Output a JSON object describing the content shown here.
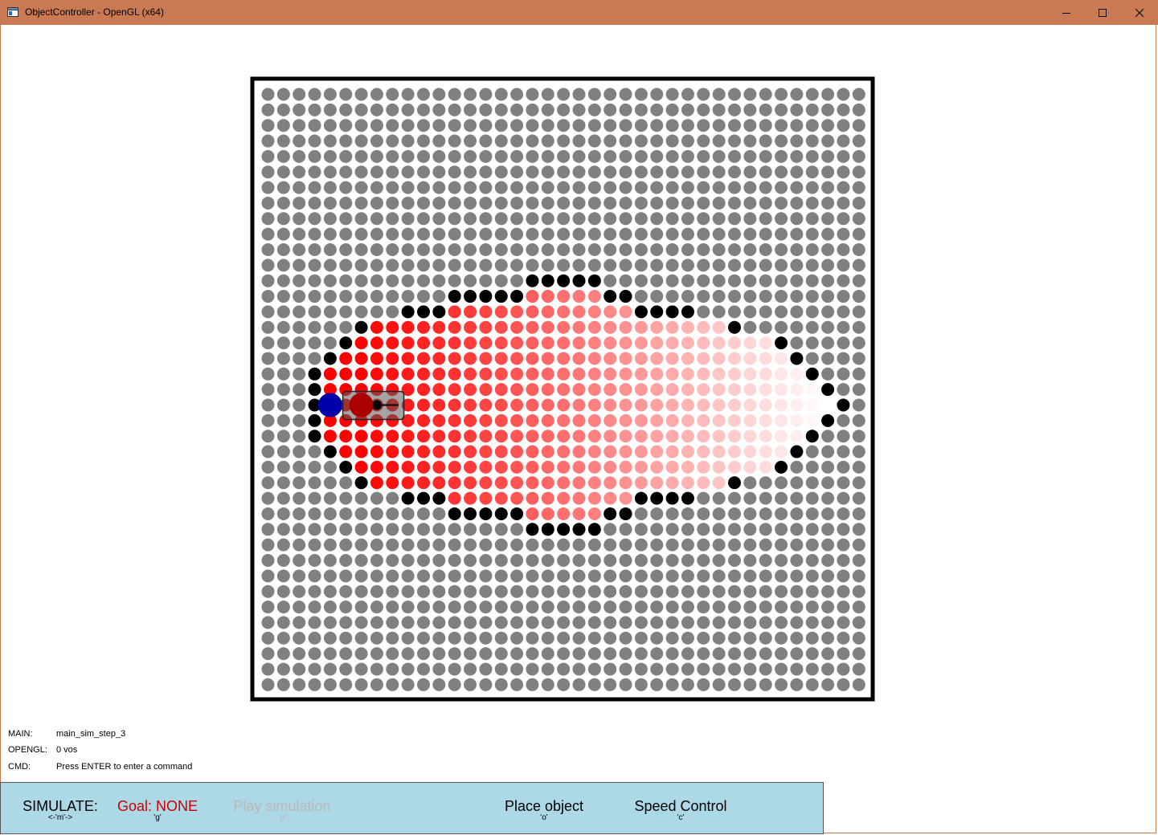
{
  "window": {
    "title": "ObjectController - OpenGL (x64)",
    "app_icon": "app-window-icon",
    "controls": [
      "minimize-icon",
      "maximize-icon",
      "close-icon"
    ]
  },
  "colors": {
    "titlebar": "#c97a52",
    "toolbar": "#add8e6",
    "empty_cell": "#808080",
    "wall_cell": "#000000",
    "path_cell_strong": "#ff0000",
    "path_cell_faint": "#ffffff",
    "start_marker": "#0000aa",
    "object_marker": "#aa0000",
    "goal_text": "#cc0000",
    "disabled_text": "#b8b8b8"
  },
  "grid": {
    "columns": 39,
    "rows": 39,
    "cell_states": [
      "empty",
      "wall",
      "path"
    ],
    "start_cell": {
      "col": 4,
      "row": 20
    },
    "object_cell": {
      "col": 6,
      "row": 20
    }
  },
  "status": {
    "main_label": "MAIN:",
    "main_value": "main_sim_step_3",
    "opengl_label": "OPENGL:",
    "opengl_value": "0 vos",
    "cmd_label": "CMD:",
    "cmd_value": "Press ENTER to enter a command"
  },
  "toolbar": {
    "simulate_label": "SIMULATE:",
    "simulate_key": "<-'m'->",
    "goal_label": "Goal: NONE",
    "goal_key": "'g'",
    "play_label": "Play simulation",
    "play_key": "'p'",
    "place_label": "Place object",
    "place_key": "'o'",
    "speed_label": "Speed Control",
    "speed_key": "'c'"
  }
}
